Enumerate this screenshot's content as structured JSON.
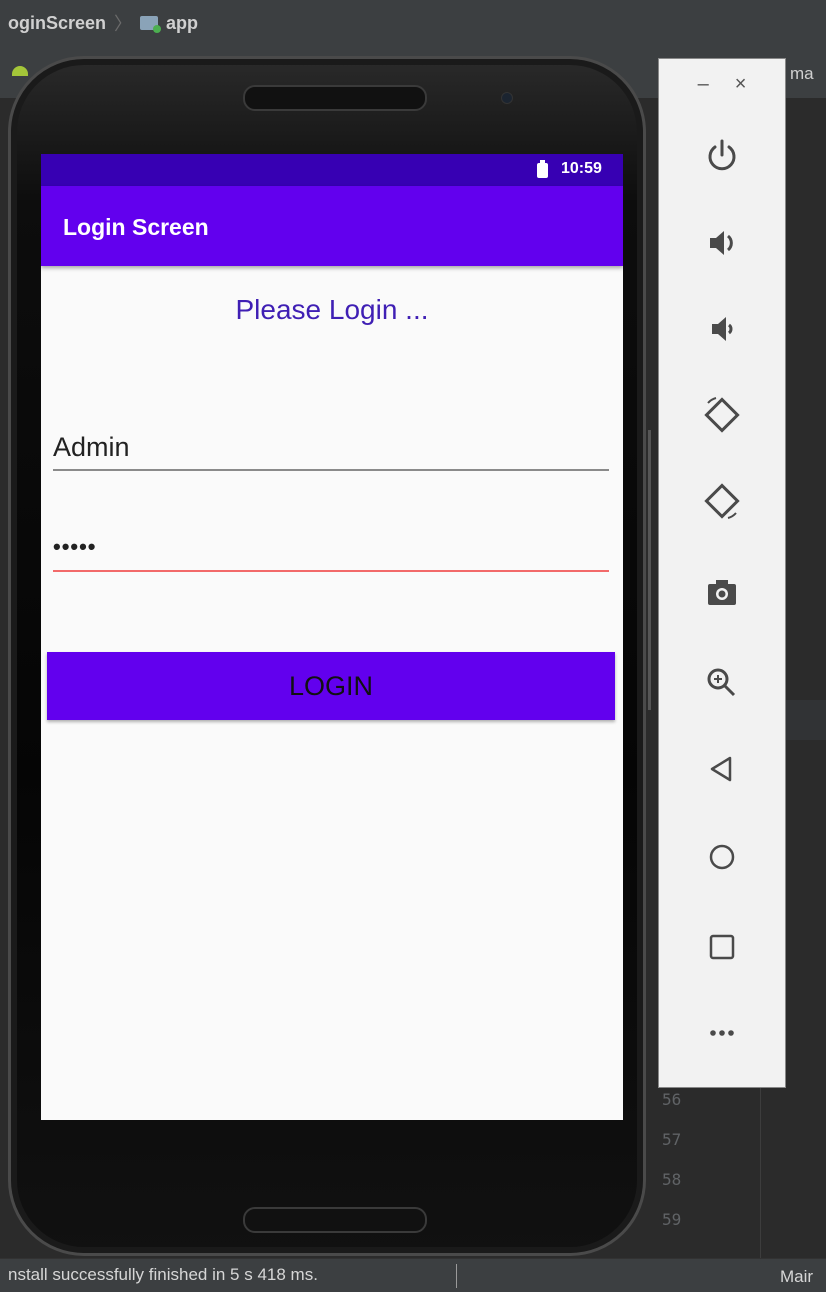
{
  "ide": {
    "breadcrumb": [
      "oginScreen",
      "app"
    ],
    "editor_tab": "ma",
    "line_numbers": [
      "56",
      "57",
      "58",
      "59"
    ],
    "status_message": "nstall successfully finished in 5 s 418 ms.",
    "status_right": "Mair"
  },
  "device": {
    "status_bar": {
      "time": "10:59"
    },
    "app_bar": {
      "title": "Login Screen"
    },
    "heading": "Please Login ...",
    "username": {
      "value": "Admin"
    },
    "password": {
      "masked_value": "•••••"
    },
    "login_button": "LOGIN"
  },
  "emulator_controls": {
    "window": {
      "minimize": "–",
      "close": "×"
    },
    "buttons": [
      "power-icon",
      "volume-up-icon",
      "volume-down-icon",
      "rotate-left-icon",
      "rotate-right-icon",
      "screenshot-icon",
      "zoom-icon",
      "back-icon",
      "home-icon",
      "overview-icon",
      "more-icon"
    ]
  },
  "colors": {
    "primary": "#6200ee",
    "primary_dark": "#3700b3",
    "heading": "#3f1fb4",
    "error_underline": "#f26a6a"
  }
}
